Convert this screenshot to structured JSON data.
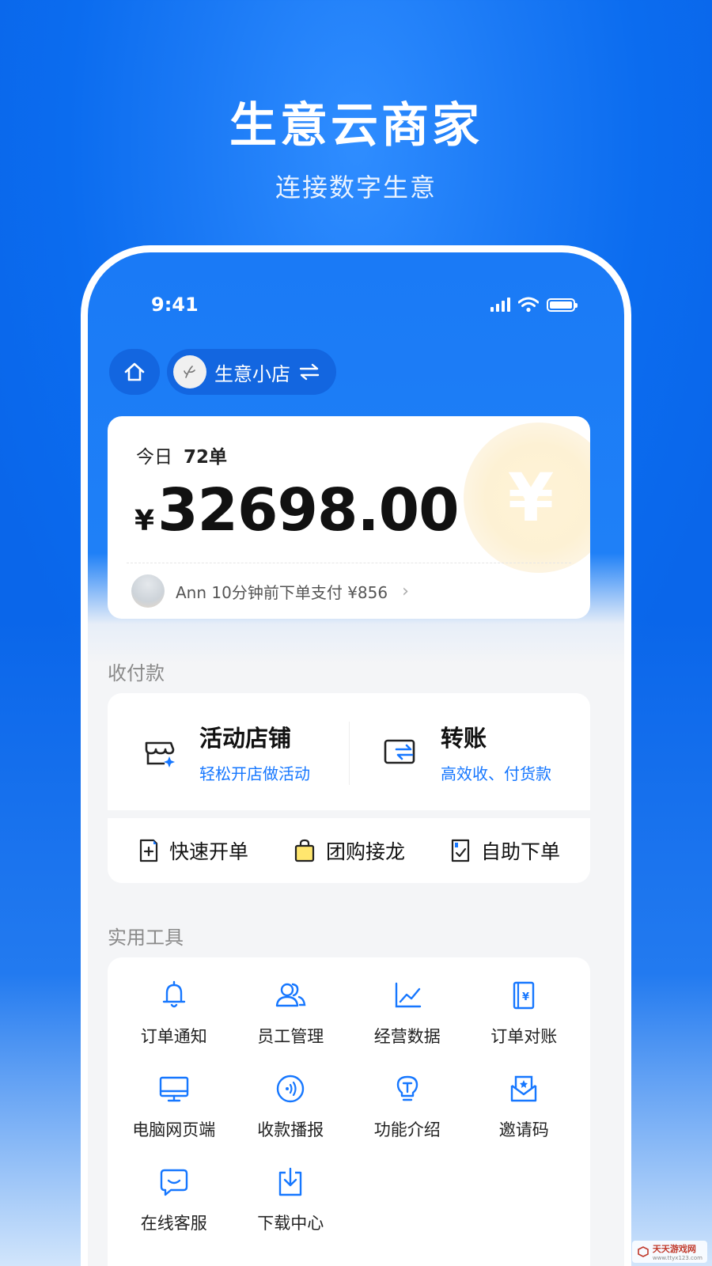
{
  "hero": {
    "title": "生意云商家",
    "subtitle": "连接数字生意"
  },
  "status_bar": {
    "time": "9:41",
    "icons": [
      "signal-icon",
      "wifi-icon",
      "battery-icon"
    ]
  },
  "header": {
    "home_icon": "home-icon",
    "store_name": "生意小店",
    "switch_icon": "switch-arrows-icon"
  },
  "sales_card": {
    "today_label": "今日",
    "order_count": "72单",
    "currency": "¥",
    "amount": "32698.00",
    "coin_symbol": "¥",
    "latest_activity": "Ann 10分钟前下单支付 ¥856",
    "chevron": "›"
  },
  "payments": {
    "section_title": "收付款",
    "primary": [
      {
        "name": "活动店铺",
        "desc": "轻松开店做活动",
        "icon": "store-icon"
      },
      {
        "name": "转账",
        "desc": "高效收、付货款",
        "icon": "transfer-icon"
      }
    ],
    "secondary": [
      {
        "label": "快速开单",
        "icon": "quick-order-icon"
      },
      {
        "label": "团购接龙",
        "icon": "shopping-bag-icon"
      },
      {
        "label": "自助下单",
        "icon": "self-order-icon"
      }
    ]
  },
  "tools": {
    "section_title": "实用工具",
    "items": [
      {
        "label": "订单通知",
        "icon": "bell-icon"
      },
      {
        "label": "员工管理",
        "icon": "staff-icon"
      },
      {
        "label": "经营数据",
        "icon": "chart-icon"
      },
      {
        "label": "订单对账",
        "icon": "ledger-icon"
      },
      {
        "label": "电脑网页端",
        "icon": "monitor-icon"
      },
      {
        "label": "收款播报",
        "icon": "broadcast-icon"
      },
      {
        "label": "功能介绍",
        "icon": "bulb-icon"
      },
      {
        "label": "邀请码",
        "icon": "invite-icon"
      },
      {
        "label": "在线客服",
        "icon": "chat-icon"
      },
      {
        "label": "下载中心",
        "icon": "download-icon"
      }
    ]
  },
  "watermark": {
    "text": "天天游戏网",
    "url_text": "www.ttyx123.com"
  },
  "colors": {
    "brand_blue": "#1677ff",
    "header_blue": "#1a7af6",
    "pill_blue": "#1366e0"
  }
}
